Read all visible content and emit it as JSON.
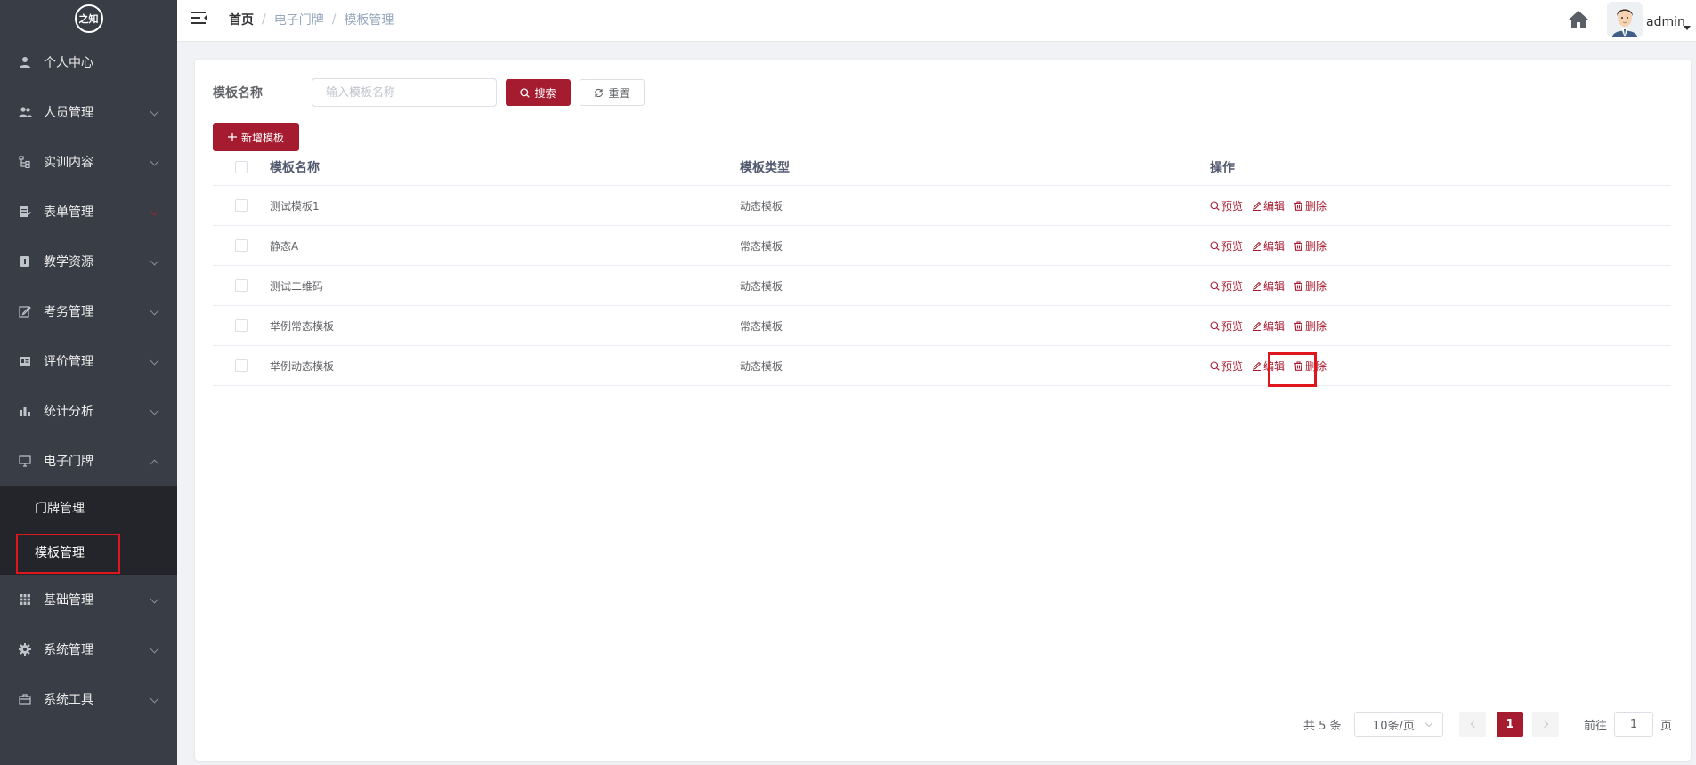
{
  "logo": {
    "text": "之知"
  },
  "sidebar": {
    "items": [
      {
        "label": "个人中心",
        "icon": "user-icon"
      },
      {
        "label": "人员管理",
        "icon": "users-icon"
      },
      {
        "label": "实训内容",
        "icon": "tree-icon"
      },
      {
        "label": "表单管理",
        "icon": "form-icon"
      },
      {
        "label": "教学资源",
        "icon": "book-icon"
      },
      {
        "label": "考务管理",
        "icon": "edit-icon"
      },
      {
        "label": "评价管理",
        "icon": "rating-icon"
      },
      {
        "label": "统计分析",
        "icon": "chart-icon"
      },
      {
        "label": "电子门牌",
        "icon": "monitor-icon"
      }
    ],
    "submenu": [
      {
        "label": "门牌管理"
      },
      {
        "label": "模板管理"
      }
    ],
    "items_after": [
      {
        "label": "基础管理",
        "icon": "table-icon"
      },
      {
        "label": "系统管理",
        "icon": "gear-icon"
      },
      {
        "label": "系统工具",
        "icon": "toolbox-icon"
      }
    ]
  },
  "header": {
    "breadcrumb": [
      "首页",
      "电子门牌",
      "模板管理"
    ],
    "user": "admin"
  },
  "search": {
    "label": "模板名称",
    "placeholder": "输入模板名称",
    "search_btn": "搜索",
    "reset_btn": "重置"
  },
  "toolbar": {
    "add_btn": "新增模板"
  },
  "table": {
    "headers": [
      "模板名称",
      "模板类型",
      "操作"
    ],
    "rows": [
      {
        "name": "测试模板1",
        "type": "动态模板"
      },
      {
        "name": "静态A",
        "type": "常态模板"
      },
      {
        "name": "测试二维码",
        "type": "动态模板"
      },
      {
        "name": "举例常态模板",
        "type": "常态模板"
      },
      {
        "name": "举例动态模板",
        "type": "动态模板"
      }
    ],
    "ops": {
      "preview": "预览",
      "edit": "编辑",
      "delete": "删除"
    }
  },
  "pagination": {
    "total": "共 5 条",
    "page_size": "10条/页",
    "current": "1",
    "goto_label": "前往",
    "goto_value": "1",
    "page_suffix": "页"
  },
  "colors": {
    "primary": "#a51c30",
    "sidebar_bg": "#393d45",
    "highlight": "#e0161e"
  }
}
